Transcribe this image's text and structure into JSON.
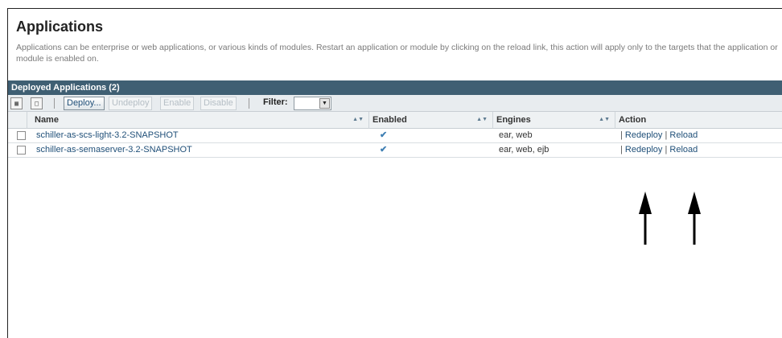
{
  "page": {
    "title": "Applications",
    "description": "Applications can be enterprise or web applications, or various kinds of modules. Restart an application or module by clicking on the reload link, this action will apply only to the targets that the application or module is enabled on."
  },
  "table": {
    "caption": "Deployed Applications (2)",
    "toolbar": {
      "select_all_icon": "select-all-icon",
      "deselect_all_icon": "deselect-all-icon",
      "deploy_label": "Deploy...",
      "undeploy_label": "Undeploy",
      "enable_label": "Enable",
      "disable_label": "Disable",
      "filter_label": "Filter:",
      "filter_value": ""
    },
    "columns": {
      "name": "Name",
      "enabled": "Enabled",
      "engines": "Engines",
      "action": "Action"
    },
    "rows": [
      {
        "name": "schiller-as-scs-light-3.2-SNAPSHOT",
        "enabled": "✔",
        "engines": "ear, web",
        "redeploy": "Redeploy",
        "reload": "Reload",
        "sep_before": "|",
        "sep_between": "|"
      },
      {
        "name": "schiller-as-semaserver-3.2-SNAPSHOT",
        "enabled": "✔",
        "engines": "ear, web, ejb",
        "redeploy": "Redeploy",
        "reload": "Reload",
        "sep_before": "|",
        "sep_between": "|"
      }
    ]
  },
  "colors": {
    "header_bar": "#3f5f73",
    "link": "#1f4f78",
    "check": "#3f7fb3"
  }
}
